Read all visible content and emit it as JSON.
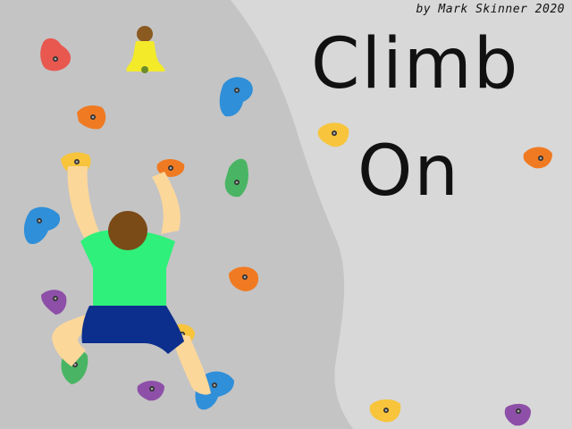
{
  "credit": "by Mark Skinner 2020",
  "title": {
    "line1": "Climb",
    "line2": "On"
  },
  "colors": {
    "wall": "#c4c4c4",
    "background": "#d8d8d8",
    "hold_red": "#e8584f",
    "hold_orange": "#f07a22",
    "hold_blue": "#2f8fd8",
    "hold_green": "#49b564",
    "hold_yellow": "#f7c43b",
    "hold_purple": "#8d4fa8",
    "bell": "#f3ea2a",
    "skin": "#fbd79a",
    "hair": "#7a4a17",
    "shirt": "#2ff07a",
    "shorts": "#0c2f8d"
  },
  "icons": {
    "bell": "bell-icon",
    "climber": "climber-figure",
    "hold": "climbing-hold-icon"
  }
}
